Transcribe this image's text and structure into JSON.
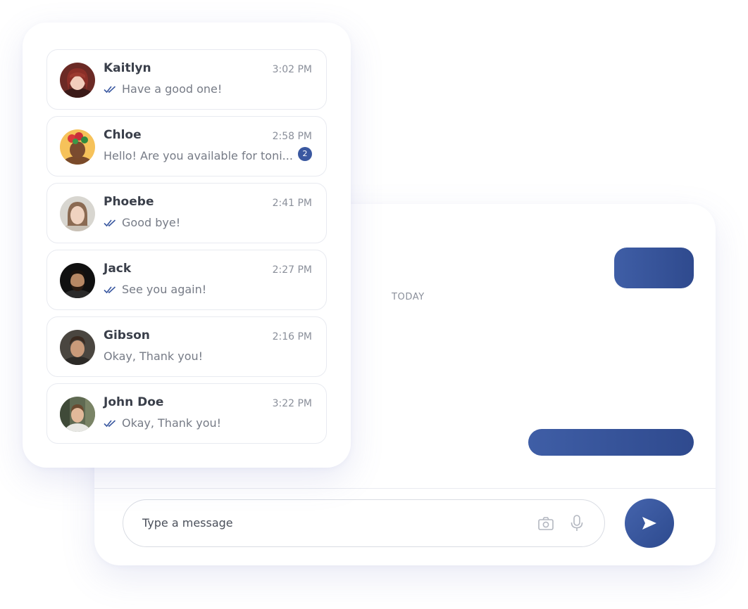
{
  "colors": {
    "accent": "#3a58a0",
    "accent_dark": "#2d4a8e",
    "text_primary": "#3a3f4a",
    "text_secondary": "#767b86",
    "read_check": "#3a58a0"
  },
  "chats": [
    {
      "name": "Kaitlyn",
      "time": "3:02 PM",
      "preview": "Have a good one!",
      "read": true,
      "unread": ""
    },
    {
      "name": "Chloe",
      "time": "2:58 PM",
      "preview": "Hello! Are you available for toni...",
      "read": false,
      "unread": "2"
    },
    {
      "name": "Phoebe",
      "time": "2:41 PM",
      "preview": "Good bye!",
      "read": true,
      "unread": ""
    },
    {
      "name": "Jack",
      "time": "2:27 PM",
      "preview": "See you again!",
      "read": true,
      "unread": ""
    },
    {
      "name": "Gibson",
      "time": "2:16 PM",
      "preview": "Okay, Thank you!",
      "read": false,
      "unread": ""
    },
    {
      "name": "John Doe",
      "time": "3:22 PM",
      "preview": "Okay, Thank you!",
      "read": true,
      "unread": ""
    }
  ],
  "conversation": {
    "date_divider": "TODAY"
  },
  "composer": {
    "placeholder": "Type a message",
    "camera_icon": "camera-icon",
    "mic_icon": "microphone-icon",
    "send_icon": "send-icon"
  }
}
